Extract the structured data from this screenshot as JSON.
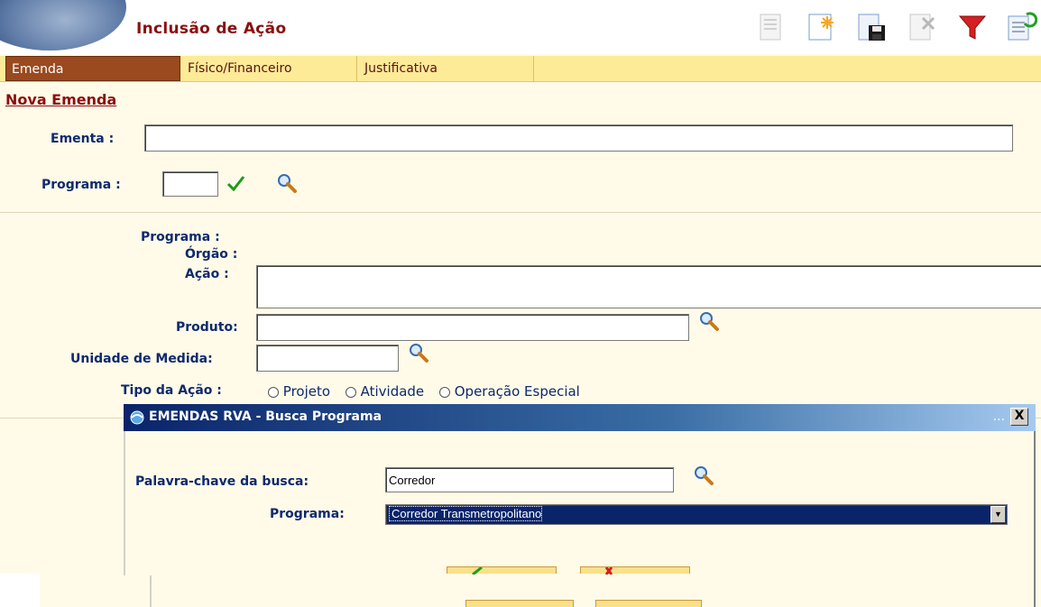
{
  "header": {
    "title": "Inclusão de Ação"
  },
  "toolbar": {
    "icons": [
      "document-icon",
      "new-document-icon",
      "save-icon",
      "delete-icon",
      "filter-icon",
      "refresh-icon"
    ]
  },
  "tabs": [
    {
      "label": "Emenda",
      "active": true
    },
    {
      "label": "Físico/Financeiro",
      "active": false
    },
    {
      "label": "Justificativa",
      "active": false
    }
  ],
  "section_title": "Nova Emenda",
  "form": {
    "ementa_label": "Ementa :",
    "ementa_value": "",
    "programa_label": "Programa :",
    "programa_value": "",
    "info_programa_label": "Programa :",
    "info_orgao_label": "Órgão :",
    "info_acao_label": "Ação :",
    "acao_value": "",
    "produto_label": "Produto:",
    "produto_value": "",
    "unidade_label": "Unidade de Medida:",
    "unidade_value": "",
    "tipo_label": "Tipo da Ação :",
    "tipo_options": [
      "Projeto",
      "Atividade",
      "Operação Especial"
    ]
  },
  "dialog": {
    "title": "EMENDAS RVA - Busca Programa",
    "title_extra": "...",
    "close_label": "X",
    "keyword_label": "Palavra-chave da busca:",
    "keyword_value": "Corredor",
    "programa_label": "Programa:",
    "programa_selected": "Corredor Transmetropolitano"
  },
  "colors": {
    "accent": "#8b0f0f",
    "label": "#0e2a6e",
    "tab_bar": "#fdeb98",
    "tab_active": "#9a4a1e",
    "dialog_title": "#0a246a"
  }
}
